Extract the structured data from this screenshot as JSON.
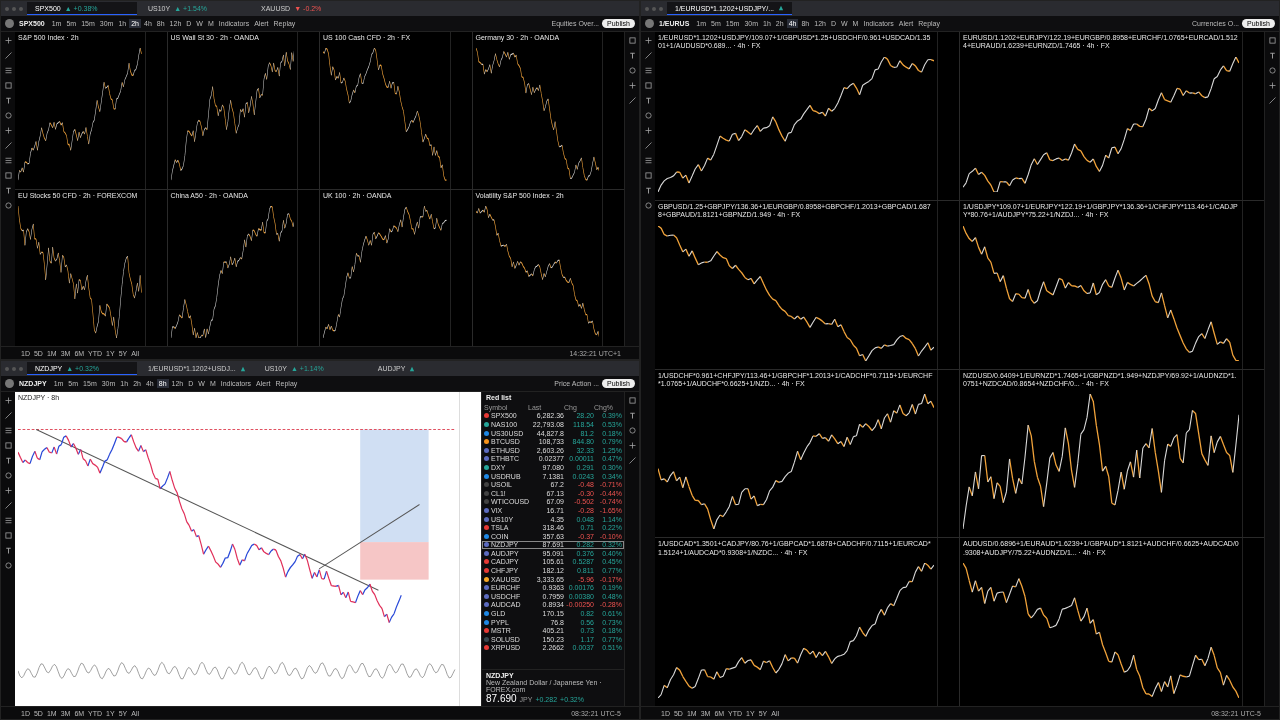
{
  "screens": [
    {
      "tabs": [
        {
          "label": "SPX500",
          "change": "▲ +0.38%",
          "rising": true,
          "selected": true
        },
        {
          "label": "US10Y",
          "change": "▲ +1.54%",
          "rising": true,
          "selected": false
        },
        {
          "label": "XAUUSD",
          "change": "▼ -0.2%",
          "rising": false,
          "selected": false
        }
      ],
      "symbol": "SPX500",
      "intervals": [
        {
          "label": "1m",
          "selected": false
        },
        {
          "label": "5m",
          "selected": false
        },
        {
          "label": "15m",
          "selected": false
        },
        {
          "label": "30m",
          "selected": false
        },
        {
          "label": "1h",
          "selected": false
        },
        {
          "label": "2h",
          "selected": true
        },
        {
          "label": "4h",
          "selected": false
        },
        {
          "label": "8h",
          "selected": false
        },
        {
          "label": "12h",
          "selected": false
        },
        {
          "label": "D",
          "selected": false
        },
        {
          "label": "W",
          "selected": false
        },
        {
          "label": "M",
          "selected": false
        }
      ],
      "indicators": "Indicators",
      "alert": "Alert",
      "replay": "Replay",
      "layout_name": "Equities Over...",
      "publish": "Publish",
      "panels": [
        {
          "title": "S&P 500 Index · 2h",
          "kind": "dark"
        },
        {
          "title": "US Wall St 30 · 2h · OANDA",
          "kind": "dark"
        },
        {
          "title": "US 100 Cash CFD · 2h · FX",
          "kind": "dark"
        },
        {
          "title": "Germany 30 · 2h · OANDA",
          "kind": "dark"
        },
        {
          "title": "EU Stocks 50 CFD · 2h · FOREXCOM",
          "kind": "dark"
        },
        {
          "title": "China A50 · 2h · OANDA",
          "kind": "dark"
        },
        {
          "title": "UK 100 · 2h · OANDA",
          "kind": "dark"
        },
        {
          "title": "Volatility S&P 500 Index · 2h",
          "kind": "dark"
        }
      ],
      "ranges": [
        "1D",
        "5D",
        "1M",
        "3M",
        "6M",
        "YTD",
        "1Y",
        "5Y",
        "All"
      ],
      "clock": "14:32:21 UTC+1"
    },
    {
      "tabs": [
        {
          "label": "NZDJPY",
          "change": "▲ +0.32%",
          "rising": true,
          "selected": true
        },
        {
          "label": "1/EURUSD*1.1202+USDJ...",
          "rising": true,
          "selected": false
        },
        {
          "label": "US10Y",
          "change": "▲ +1.14%",
          "rising": true,
          "selected": false
        },
        {
          "label": "AUDJPY",
          "rising": true,
          "selected": false
        }
      ],
      "symbol": "NZDJPY",
      "intervals": [
        {
          "label": "1m",
          "selected": false
        },
        {
          "label": "5m",
          "selected": false
        },
        {
          "label": "15m",
          "selected": false
        },
        {
          "label": "30m",
          "selected": false
        },
        {
          "label": "1h",
          "selected": false
        },
        {
          "label": "2h",
          "selected": false
        },
        {
          "label": "4h",
          "selected": false
        },
        {
          "label": "8h",
          "selected": true
        },
        {
          "label": "12h",
          "selected": false
        },
        {
          "label": "D",
          "selected": false
        },
        {
          "label": "W",
          "selected": false
        },
        {
          "label": "M",
          "selected": false
        }
      ],
      "indicators": "Indicators",
      "alert": "Alert",
      "replay": "Replay",
      "layout_name": "Price Action ...",
      "publish": "Publish",
      "panels": [
        {
          "title": "NZDJPY · 8h",
          "kind": "light"
        }
      ],
      "watchlist": {
        "title": "Red list",
        "headers": [
          "Symbol",
          "Last",
          "Chg",
          "Chg%"
        ],
        "rows": [
          {
            "symbol": "SPX500",
            "last": "6,282.36",
            "chg": "28.20",
            "chg_pct": "0.39%",
            "rising": true,
            "selected": false,
            "color": "#e53935"
          },
          {
            "symbol": "NAS100",
            "last": "22,793.08",
            "chg": "118.54",
            "chg_pct": "0.53%",
            "rising": true,
            "selected": false,
            "color": "#26a69a"
          },
          {
            "symbol": "US30USD",
            "last": "44,827.8",
            "chg": "81.2",
            "chg_pct": "0.18%",
            "rising": true,
            "selected": false,
            "color": "#1e88e5"
          },
          {
            "symbol": "BTCUSD",
            "last": "108,733",
            "chg": "844.80",
            "chg_pct": "0.79%",
            "rising": true,
            "selected": false,
            "color": "#f7931a"
          },
          {
            "symbol": "ETHUSD",
            "last": "2,603.26",
            "chg": "32.33",
            "chg_pct": "1.25%",
            "rising": true,
            "selected": false,
            "color": "#5c6bc0"
          },
          {
            "symbol": "ETHBTC",
            "last": "0.02377",
            "chg": "0.00011",
            "chg_pct": "0.47%",
            "rising": true,
            "selected": false,
            "color": "#5c6bc0"
          },
          {
            "symbol": "DXY",
            "last": "97.080",
            "chg": "0.291",
            "chg_pct": "0.30%",
            "rising": true,
            "selected": false,
            "color": "#26a69a"
          },
          {
            "symbol": "USDRUB",
            "last": "7.1381",
            "chg": "0.0243",
            "chg_pct": "0.34%",
            "rising": true,
            "selected": false,
            "color": "#1e88e5"
          },
          {
            "symbol": "USOIL",
            "last": "67.2",
            "chg": "-0.48",
            "chg_pct": "-0.71%",
            "rising": false,
            "selected": false,
            "color": "#424242"
          },
          {
            "symbol": "CL1!",
            "last": "67.13",
            "chg": "-0.30",
            "chg_pct": "-0.44%",
            "rising": false,
            "selected": false,
            "color": "#424242"
          },
          {
            "symbol": "WTICOUSD",
            "last": "67.09",
            "chg": "-0.502",
            "chg_pct": "-0.74%",
            "rising": false,
            "selected": false,
            "color": "#424242"
          },
          {
            "symbol": "VIX",
            "last": "16.71",
            "chg": "-0.28",
            "chg_pct": "-1.65%",
            "rising": false,
            "selected": false,
            "color": "#5c6bc0"
          },
          {
            "symbol": "US10Y",
            "last": "4.35",
            "chg": "0.048",
            "chg_pct": "1.14%",
            "rising": true,
            "selected": false,
            "color": "#5c6bc0"
          },
          {
            "symbol": "TSLA",
            "last": "318.46",
            "chg": "0.71",
            "chg_pct": "0.22%",
            "rising": true,
            "selected": false,
            "color": "#e53935"
          },
          {
            "symbol": "COIN",
            "last": "357.63",
            "chg": "-0.37",
            "chg_pct": "-0.10%",
            "rising": false,
            "selected": false,
            "color": "#1e88e5"
          },
          {
            "symbol": "NZDJPY",
            "last": "87.691",
            "chg": "0.282",
            "chg_pct": "0.32%",
            "rising": true,
            "selected": true,
            "color": "#5c6bc0"
          },
          {
            "symbol": "AUDJPY",
            "last": "95.091",
            "chg": "0.376",
            "chg_pct": "0.40%",
            "rising": true,
            "selected": false,
            "color": "#5c6bc0"
          },
          {
            "symbol": "CADJPY",
            "last": "105.61",
            "chg": "0.5287",
            "chg_pct": "0.45%",
            "rising": true,
            "selected": false,
            "color": "#e53935"
          },
          {
            "symbol": "CHFJPY",
            "last": "182.12",
            "chg": "0.811",
            "chg_pct": "0.77%",
            "rising": true,
            "selected": false,
            "color": "#e53935"
          },
          {
            "symbol": "XAUUSD",
            "last": "3,333.65",
            "chg": "-5.96",
            "chg_pct": "-0.17%",
            "rising": false,
            "selected": false,
            "color": "#f9a825"
          },
          {
            "symbol": "EURCHF",
            "last": "0.9363",
            "chg": "0.00176",
            "chg_pct": "0.19%",
            "rising": true,
            "selected": false,
            "color": "#5c6bc0"
          },
          {
            "symbol": "USDCHF",
            "last": "0.7959",
            "chg": "0.00380",
            "chg_pct": "0.48%",
            "rising": true,
            "selected": false,
            "color": "#5c6bc0"
          },
          {
            "symbol": "AUDCAD",
            "last": "0.8934",
            "chg": "-0.00250",
            "chg_pct": "-0.28%",
            "rising": false,
            "selected": false,
            "color": "#5c6bc0"
          },
          {
            "symbol": "GLD",
            "last": "170.15",
            "chg": "0.82",
            "chg_pct": "0.61%",
            "rising": true,
            "selected": false,
            "color": "#1e88e5"
          },
          {
            "symbol": "PYPL",
            "last": "76.8",
            "chg": "0.56",
            "chg_pct": "0.73%",
            "rising": true,
            "selected": false,
            "color": "#1e88e5"
          },
          {
            "symbol": "MSTR",
            "last": "405.21",
            "chg": "0.73",
            "chg_pct": "0.18%",
            "rising": true,
            "selected": false,
            "color": "#e53935"
          },
          {
            "symbol": "SOLUSD",
            "last": "150.23",
            "chg": "1.17",
            "chg_pct": "0.77%",
            "rising": true,
            "selected": false,
            "color": "#37474f"
          },
          {
            "symbol": "XRPUSD",
            "last": "2.2662",
            "chg": "0.0037",
            "chg_pct": "0.51%",
            "rising": true,
            "selected": false,
            "color": "#e53935"
          }
        ],
        "detail": {
          "symbol": "NZDJPY",
          "name": "New Zealand Dollar / Japanese Yen · FOREX.com",
          "price": "87.690",
          "currency": "JPY",
          "chg": "+0.282",
          "chg_pct": "+0.32%"
        }
      },
      "ranges": [
        "1D",
        "5D",
        "1M",
        "3M",
        "6M",
        "YTD",
        "1Y",
        "5Y",
        "All"
      ],
      "clock": "08:32:21 UTC-5"
    },
    {
      "tabs": [
        {
          "label": "1/EURUSD*1.1202+USDJPY/...",
          "rising": true,
          "selected": true
        }
      ],
      "symbol": "1/EURUS",
      "intervals": [
        {
          "label": "1m",
          "selected": false
        },
        {
          "label": "5m",
          "selected": false
        },
        {
          "label": "15m",
          "selected": false
        },
        {
          "label": "30m",
          "selected": false
        },
        {
          "label": "1h",
          "selected": false
        },
        {
          "label": "2h",
          "selected": false
        },
        {
          "label": "4h",
          "selected": true
        },
        {
          "label": "8h",
          "selected": false
        },
        {
          "label": "12h",
          "selected": false
        },
        {
          "label": "D",
          "selected": false
        },
        {
          "label": "W",
          "selected": false
        },
        {
          "label": "M",
          "selected": false
        }
      ],
      "indicators": "Indicators",
      "alert": "Alert",
      "replay": "Replay",
      "layout_name": "Currencies O...",
      "publish": "Publish",
      "panels": [
        {
          "title": "1/EURUSD*1.1202+USDJPY/109.07+1/GBPUSD*1.25+USDCHF/0.961+USDCAD/1.3501+1/AUDUSD*0.689... · 4h · FX",
          "kind": "dark"
        },
        {
          "title": "EURUSD/1.1202+EURJPY/122.19+EURGBP/0.8958+EURCHF/1.0765+EURCAD/1.5124+EURAUD/1.6239+EURNZD/1.7465 · 4h · FX",
          "kind": "dark"
        },
        {
          "title": "GBPUSD/1.25+GBPJPY/136.36+1/EURGBP/0.8958+GBPCHF/1.2013+GBPCAD/1.6878+GBPAUD/1.8121+GBPNZD/1.949 · 4h · FX",
          "kind": "dark"
        },
        {
          "title": "1/USDJPY*109.07+1/EURJPY*122.19+1/GBPJPY*136.36+1/CHFJPY*113.46+1/CADJPY*80.76+1/AUDJPY*75.22+1/NZDJ... · 4h · FX",
          "kind": "dark"
        },
        {
          "title": "1/USDCHF*0.961+CHFJPY/113.46+1/GBPCHF*1.2013+1/CADCHF*0.7115+1/EURCHF*1.0765+1/AUDCHF*0.6625+1/NZD... · 4h · FX",
          "kind": "dark"
        },
        {
          "title": "NZDUSD/0.6409+1/EURNZD*1.7465+1/GBPNZD*1.949+NZDJPY/69.92+1/AUDNZD*1.0751+NZDCAD/0.8654+NZDCHF/0... · 4h · FX",
          "kind": "dark"
        },
        {
          "title": "1/USDCAD*1.3501+CADJPY/80.76+1/GBPCAD*1.6878+CADCHF/0.7115+1/EURCAD*1.5124+1/AUDCAD*0.9308+1/NZDC... · 4h · FX",
          "kind": "dark"
        },
        {
          "title": "AUDUSD/0.6896+1/EURAUD*1.6239+1/GBPAUD*1.8121+AUDCHF/0.6625+AUDCAD/0.9308+AUDJPY/75.22+AUDNZD/1... · 4h · FX",
          "kind": "dark"
        }
      ],
      "ranges": [
        "1D",
        "5D",
        "1M",
        "3M",
        "6M",
        "YTD",
        "1Y",
        "5Y",
        "All"
      ],
      "clock": "08:32:21 UTC-5"
    }
  ]
}
